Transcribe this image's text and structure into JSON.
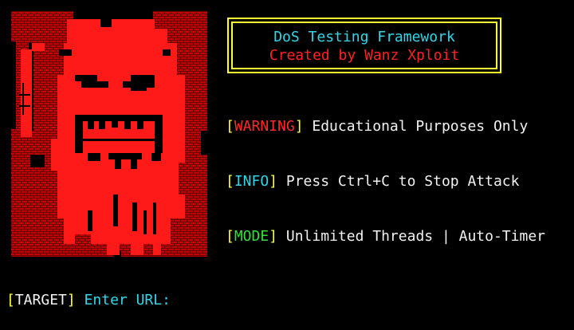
{
  "colors": {
    "background": "#000000",
    "art_red": "#ff1a1a",
    "art_dark_red": "#b00000",
    "bracket_yellow": "#ffff33",
    "cyan": "#33d6e8",
    "red_text": "#ff2222",
    "green": "#33e03a",
    "white": "#f2f2f2"
  },
  "ascii_art": {
    "icon": "red-devil-skull-icon"
  },
  "banner": {
    "title": "DoS Testing Framework",
    "credit": "Created by Wanz Xploit"
  },
  "info": [
    {
      "tag": "WARNING",
      "text": " Educational Purposes Only"
    },
    {
      "tag": "INFO",
      "text": " Press Ctrl+C to Stop Attack"
    },
    {
      "tag": "MODE",
      "text": " Unlimited Threads | Auto-Timer"
    }
  ],
  "brackets": {
    "open": "[",
    "close": "]"
  },
  "prompt": {
    "tag": "TARGET",
    "label": " Enter URL: ",
    "value": ""
  }
}
